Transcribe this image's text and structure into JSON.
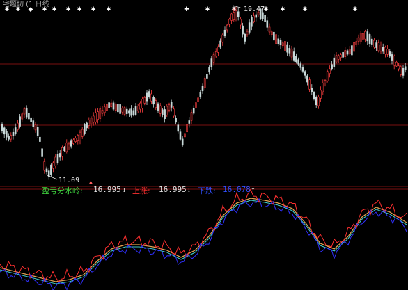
{
  "header": {
    "title_text": "宅题切 (1 日线"
  },
  "markers": {
    "top_row": [
      "✱",
      "✱",
      "◆",
      "✱",
      "✱",
      "✱",
      "✱",
      "✱",
      "✚",
      "✱",
      "✱",
      "✱",
      "✱",
      "✱"
    ]
  },
  "price_chart": {
    "high_label": "19.47",
    "low_label": "11.09"
  },
  "indicator": {
    "name": "盈亏分水岭:",
    "value1": "16.995",
    "arrow1": "↓",
    "label2": "上涨:",
    "value2": "16.995",
    "arrow2": "↓",
    "label3": "下跌:",
    "value3": "16.078",
    "arrow3": "↑"
  },
  "colors": {
    "background": "#000000",
    "up_candle": "#ff4040",
    "down_candle": "#c8d8d8",
    "gridline": "#7a1010",
    "high_low_label": "#e8e8e8",
    "indicator_name": "#3fd43f",
    "indicator_value": "#e0e0e0",
    "up_label": "#ff3030",
    "down_label": "#3050ff",
    "line_orange": "#e0a050",
    "line_cyan": "#40c8c8",
    "line_red": "#ff3030",
    "line_blue": "#3030ff"
  }
}
